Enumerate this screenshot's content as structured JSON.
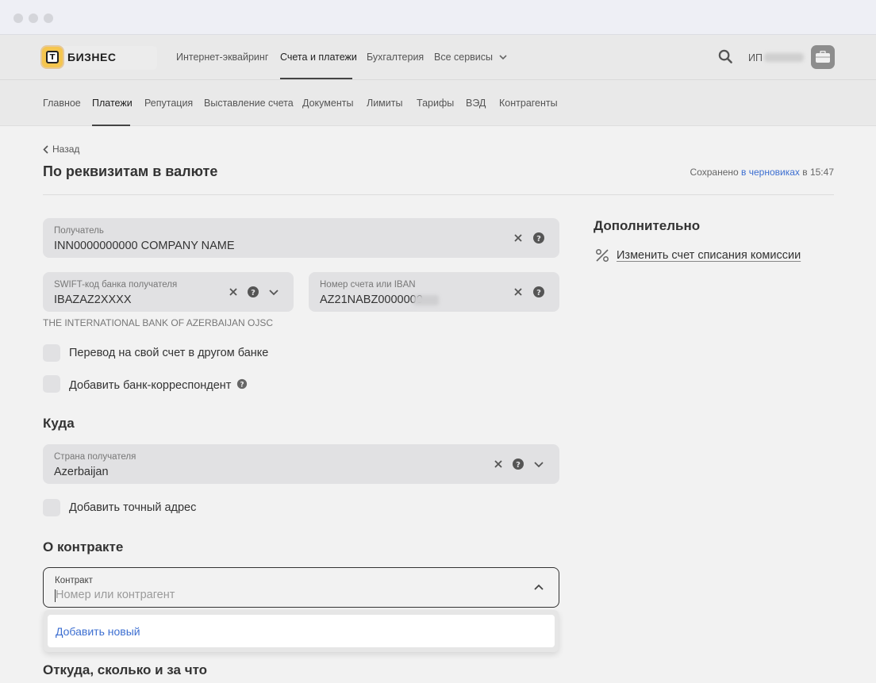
{
  "header": {
    "brand": "БИЗНЕС",
    "nav": [
      "Интернет-эквайринг",
      "Счета и платежи",
      "Бухгалтерия",
      "Все сервисы"
    ],
    "active_nav": "Счета и платежи",
    "user_prefix": "ИП"
  },
  "subnav": {
    "items": [
      "Главное",
      "Платежи",
      "Репутация",
      "Выставление счета",
      "Документы",
      "Лимиты",
      "Тарифы",
      "ВЭД",
      "Контрагенты"
    ],
    "active": "Платежи"
  },
  "page": {
    "back_label": "Назад",
    "title": "По реквизитам в валюте",
    "saved_prefix": "Сохранено",
    "saved_link": "в черновиках",
    "saved_suffix": "в 15:47"
  },
  "form": {
    "recipient": {
      "label": "Получатель",
      "value": "INN0000000000 COMPANY NAME"
    },
    "swift": {
      "label": "SWIFT-код банка получателя",
      "value": "IBAZAZ2XXXX"
    },
    "account": {
      "label": "Номер счета или IBAN",
      "value": "AZ21NABZ0000000"
    },
    "bank_name": "THE INTERNATIONAL BANK OF AZERBAIJAN OJSC",
    "checkbox_own_account": "Перевод на свой счет в другом банке",
    "checkbox_correspondent": "Добавить банк-корреспондент",
    "section_where": "Куда",
    "country": {
      "label": "Страна получателя",
      "value": "Azerbaijan"
    },
    "checkbox_address": "Добавить точный адрес",
    "section_contract": "О контракте",
    "contract": {
      "label": "Контракт",
      "placeholder": "Номер или контрагент"
    },
    "dropdown_option": "Добавить новый",
    "section_from": "Откуда, сколько и за что"
  },
  "sidebar": {
    "title": "Дополнительно",
    "link": "Изменить счет списания комиссии"
  },
  "colors": {
    "accent_link": "#3d6fd1",
    "field_bg": "#e1e1e3",
    "page_bg": "#f2f2f2"
  }
}
